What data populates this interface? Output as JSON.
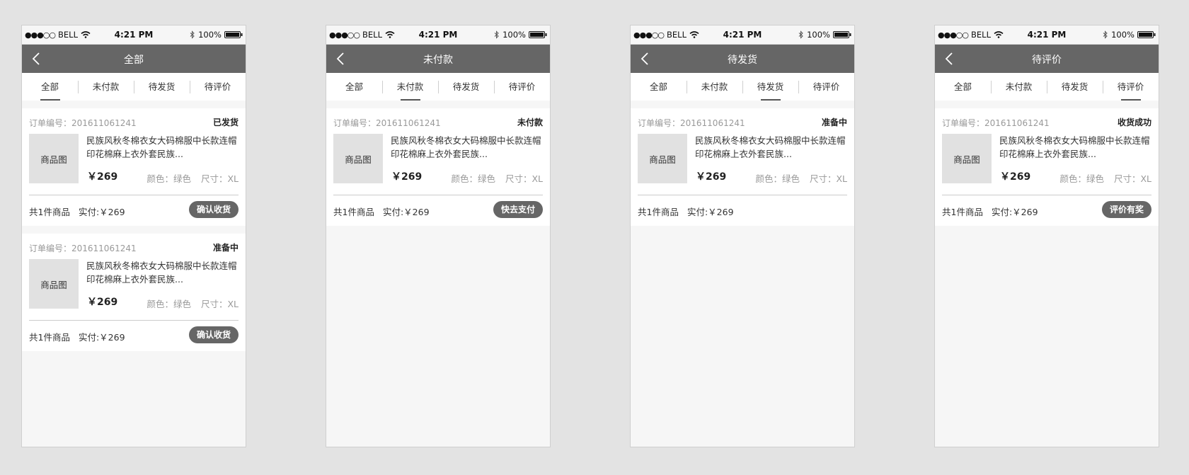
{
  "status_bar": {
    "signal": "●●●○○",
    "carrier": "BELL",
    "time": "4:21 PM",
    "battery": "100%"
  },
  "tabs": [
    "全部",
    "未付款",
    "待发货",
    "待评价"
  ],
  "screens": [
    {
      "title": "全部",
      "active_tab": 0,
      "orders": [
        {
          "order_no": "订单编号：201611061241",
          "status": "已发货",
          "thumb": "商品图",
          "product_title": "民族风秋冬棉衣女大码棉服中长款连帽印花棉麻上衣外套民族...",
          "price": "￥269",
          "color": "颜色：绿色",
          "size": "尺寸：XL",
          "count": "共1件商品",
          "paid": "实付:￥269",
          "action": "确认收货"
        },
        {
          "order_no": "订单编号：201611061241",
          "status": "准备中",
          "thumb": "商品图",
          "product_title": "民族风秋冬棉衣女大码棉服中长款连帽印花棉麻上衣外套民族...",
          "price": "￥269",
          "color": "颜色：绿色",
          "size": "尺寸：XL",
          "count": "共1件商品",
          "paid": "实付:￥269",
          "action": "确认收货"
        }
      ]
    },
    {
      "title": "未付款",
      "active_tab": 1,
      "orders": [
        {
          "order_no": "订单编号：201611061241",
          "status": "未付款",
          "thumb": "商品图",
          "product_title": "民族风秋冬棉衣女大码棉服中长款连帽印花棉麻上衣外套民族...",
          "price": "￥269",
          "color": "颜色：绿色",
          "size": "尺寸：XL",
          "count": "共1件商品",
          "paid": "实付:￥269",
          "action": "快去支付"
        }
      ]
    },
    {
      "title": "待发货",
      "active_tab": 2,
      "orders": [
        {
          "order_no": "订单编号：201611061241",
          "status": "准备中",
          "thumb": "商品图",
          "product_title": "民族风秋冬棉衣女大码棉服中长款连帽印花棉麻上衣外套民族...",
          "price": "￥269",
          "color": "颜色：绿色",
          "size": "尺寸：XL",
          "count": "共1件商品",
          "paid": "实付:￥269",
          "action": ""
        }
      ]
    },
    {
      "title": "待评价",
      "active_tab": 3,
      "orders": [
        {
          "order_no": "订单编号：201611061241",
          "status": "收货成功",
          "thumb": "商品图",
          "product_title": "民族风秋冬棉衣女大码棉服中长款连帽印花棉麻上衣外套民族...",
          "price": "￥269",
          "color": "颜色：绿色",
          "size": "尺寸：XL",
          "count": "共1件商品",
          "paid": "实付:￥269",
          "action": "评价有奖"
        }
      ]
    }
  ],
  "colors": {
    "background": "#e3e3e3",
    "navbar": "#666666",
    "action_button": "#666666",
    "muted_text": "#999999"
  },
  "icons": {
    "back": "chevron-left-icon",
    "wifi": "wifi-icon",
    "bluetooth": "bluetooth-icon",
    "battery": "battery-icon"
  }
}
